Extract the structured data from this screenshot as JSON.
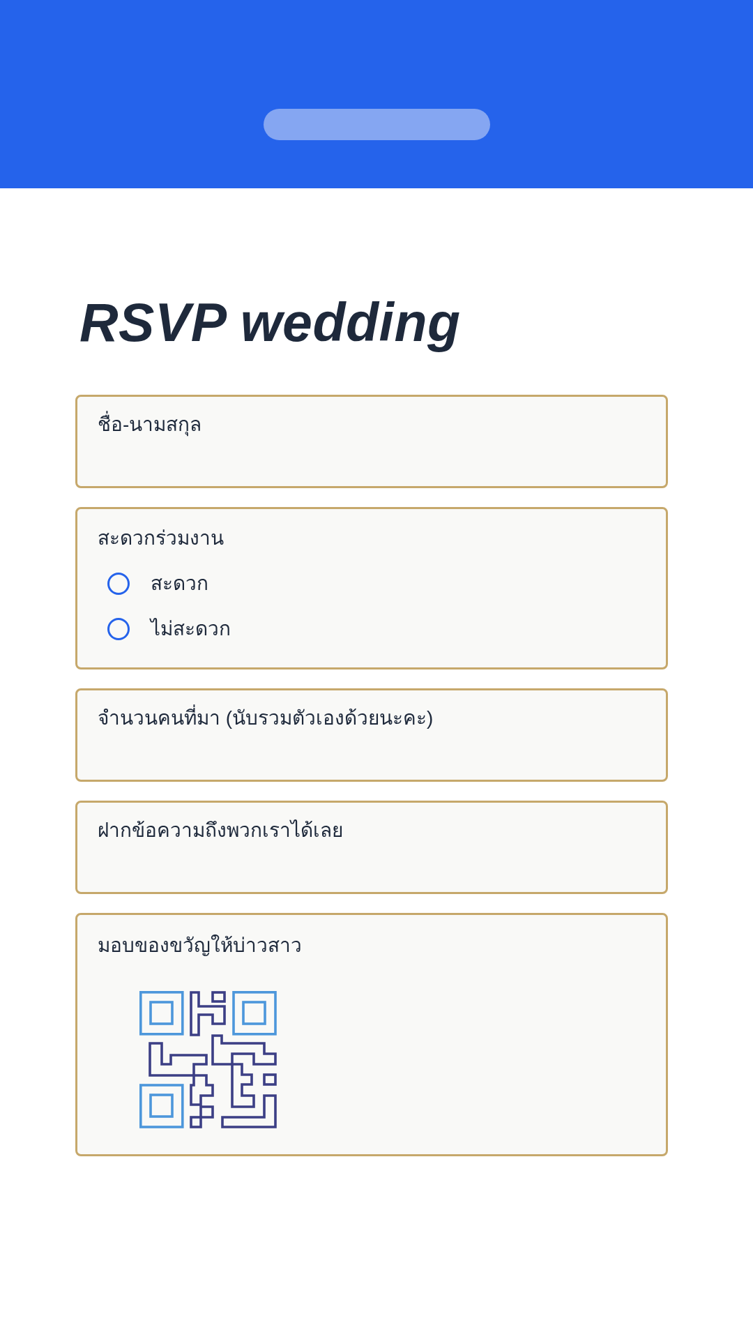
{
  "title": "RSVP wedding",
  "questions": [
    {
      "kind": "text",
      "label": "ชื่อ-นามสกุล"
    },
    {
      "kind": "choice",
      "label": "สะดวกร่วมงาน",
      "options": [
        {
          "label": "สะดวก",
          "selected": false
        },
        {
          "label": "ไม่สะดวก",
          "selected": false
        }
      ]
    },
    {
      "kind": "text",
      "label": "จำนวนคนที่มา (นับรวมตัวเองด้วยนะคะ)"
    },
    {
      "kind": "text",
      "label": "ฝากข้อความถึงพวกเราได้เลย"
    },
    {
      "kind": "qr",
      "label": "มอบของขวัญให้บ่าวสาว"
    }
  ]
}
